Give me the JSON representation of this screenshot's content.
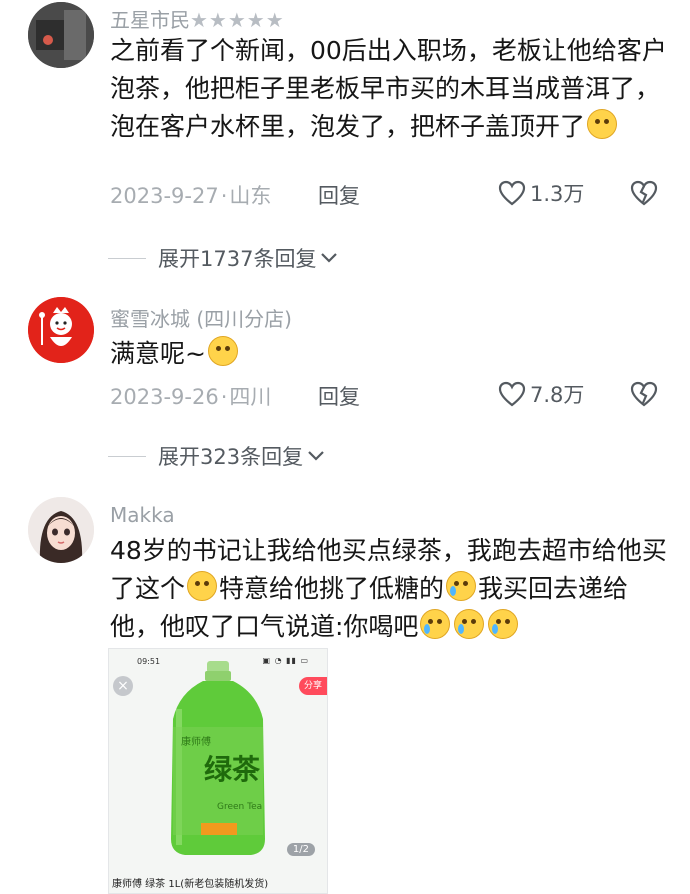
{
  "comments": [
    {
      "author": "五星市民",
      "author_suffix": "★★★★★",
      "text_parts": [
        "之前看了个新闻，00后出入职场，老板让他给客户泡茶，他把柜子里老板早市买的木耳当成普洱了，泡在客户水杯里，泡发了，把杯子盖顶开了"
      ],
      "date": "2023-9-27",
      "location": "山东",
      "reply_label": "回复",
      "likes": "1.3万",
      "expand_label": "展开1737条回复"
    },
    {
      "author": "蜜雪冰城 (四川分店)",
      "text_parts": [
        "满意呢~"
      ],
      "date": "2023-9-26",
      "location": "四川",
      "reply_label": "回复",
      "likes": "7.8万",
      "expand_label": "展开323条回复"
    },
    {
      "author": "Makka",
      "text_parts": [
        "48岁的书记让我给他买点绿茶，我跑去超市给他买了这个",
        "特意给他挑了低糖的",
        "我买回去递给他，他叹了口气说道:你喝吧"
      ]
    }
  ],
  "separator": "·",
  "image_card": {
    "status_time": "09:51",
    "share_label": "分享",
    "page_indicator": "1/2",
    "product_title": "康师傅 绿茶 1L(新老包装随机发货)",
    "brand": "康师傅",
    "bottle_text": "绿茶",
    "bottle_sub": "Green Tea"
  },
  "colors": {
    "meta_gray": "#a7acb1",
    "bottle_green": "#5fcb3a",
    "mixue_red": "#e2231a"
  }
}
